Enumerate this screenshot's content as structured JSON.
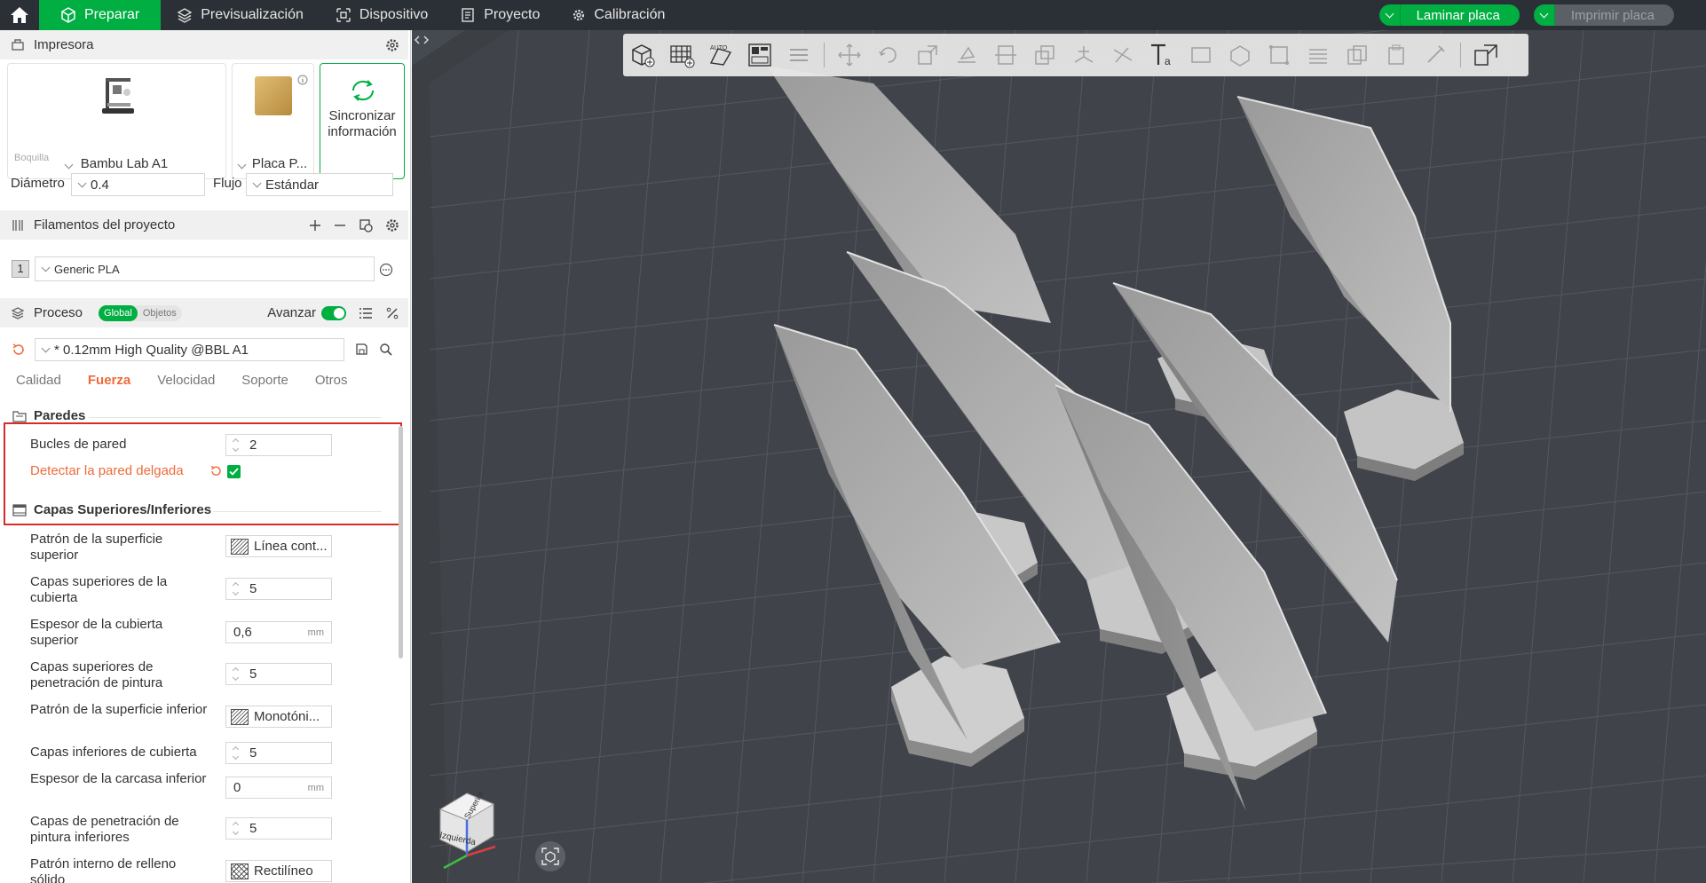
{
  "colors": {
    "accent": "#00ae42",
    "warning": "#ed6b3a",
    "highlight_box": "#d72b2b",
    "topbar": "#2b3036",
    "viewport": "#454a50"
  },
  "topbar": {
    "tabs": [
      {
        "label": "Preparar",
        "icon": "cube-icon",
        "active": true
      },
      {
        "label": "Previsualización",
        "icon": "layers-icon"
      },
      {
        "label": "Dispositivo",
        "icon": "device-icon"
      },
      {
        "label": "Proyecto",
        "icon": "document-icon"
      },
      {
        "label": "Calibración",
        "icon": "gear-icon"
      }
    ],
    "slice_label": "Laminar placa",
    "print_label": "Imprimir placa"
  },
  "printer": {
    "title": "Impresora",
    "printer_name": "Bambu Lab A1",
    "plate_name": "Placa P...",
    "sync_label": "Sincronizar información",
    "nozzle_caption": "Boquilla",
    "diameter_label": "Diámetro",
    "diameter_value": "0.4",
    "flow_label": "Flujo",
    "flow_value": "Estándar"
  },
  "filaments": {
    "title": "Filamentos del proyecto",
    "items": [
      {
        "index": "1",
        "name": "Generic PLA"
      }
    ]
  },
  "process": {
    "title": "Proceso",
    "scope_global": "Global",
    "scope_objects": "Objetos",
    "advanced_label": "Avanzar",
    "advanced_on": true,
    "preset": "* 0.12mm High Quality @BBL A1",
    "subtabs": [
      "Calidad",
      "Fuerza",
      "Velocidad",
      "Soporte",
      "Otros"
    ],
    "active_subtab": "Fuerza"
  },
  "walls": {
    "title": "Paredes",
    "loops_label": "Bucles de pared",
    "loops_value": "2",
    "thin_wall_label": "Detectar la pared delgada",
    "thin_wall_checked": true
  },
  "topbottom": {
    "title": "Capas Superiores/Inferiores",
    "top_pattern_label": "Patrón de la superficie superior",
    "top_pattern_value": "Línea cont...",
    "top_layers_label": "Capas superiores de la cubierta",
    "top_layers_value": "5",
    "top_thickness_label": "Espesor de la cubierta superior",
    "top_thickness_value": "0,6",
    "top_paint_label": "Capas superiores de penetración de pintura",
    "top_paint_value": "5",
    "bottom_pattern_label": "Patrón de la superficie inferior",
    "bottom_pattern_value": "Monotóni...",
    "bottom_layers_label": "Capas inferiores de cubierta",
    "bottom_layers_value": "5",
    "bottom_thickness_label": "Espesor de la carcasa inferior",
    "bottom_thickness_value": "0",
    "bottom_paint_label": "Capas de penetración de pintura inferiores",
    "bottom_paint_value": "5",
    "infill_pattern_label": "Patrón interno de relleno sólido",
    "infill_pattern_value": "Rectilíneo",
    "unit_mm": "mm"
  },
  "viewcube": {
    "top_label": "Superior",
    "left_label": "Izquierda"
  }
}
